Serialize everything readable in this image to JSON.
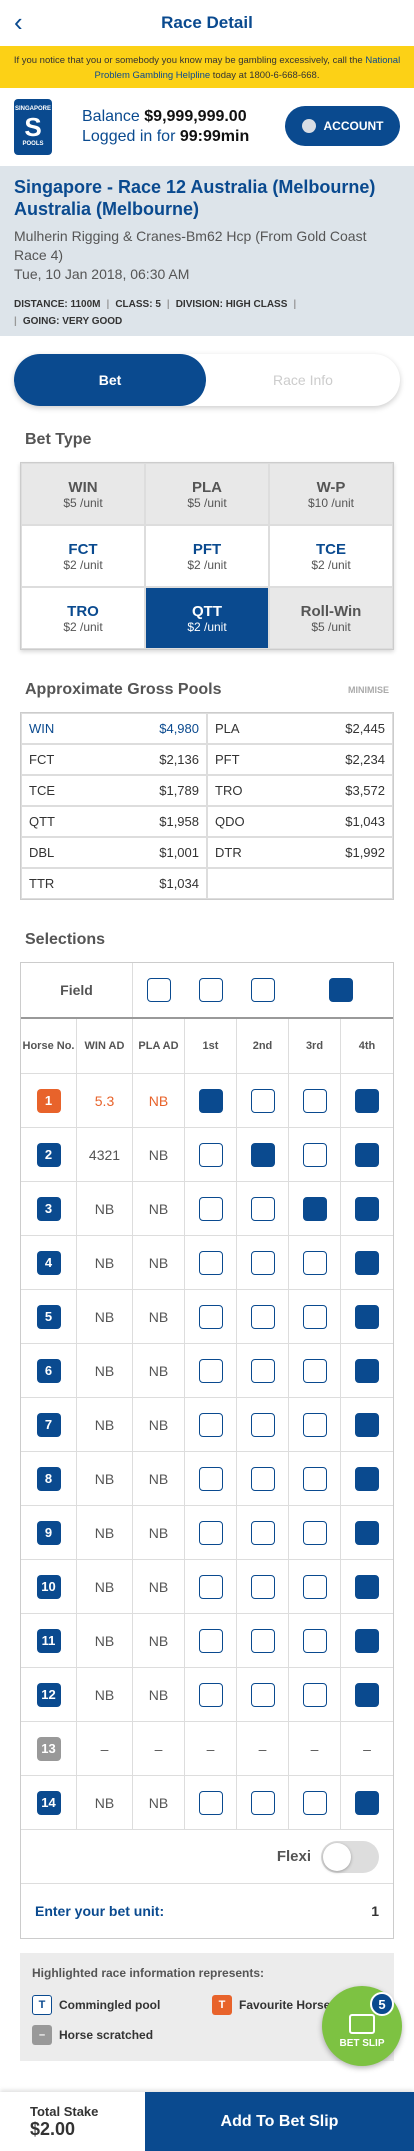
{
  "header": {
    "back_icon": "chevron-left-icon",
    "title": "Race Detail"
  },
  "warning": {
    "text": "If you notice that you or somebody you know may be gambling excessively, call the",
    "link": "National Problem Gambling Helpline",
    "suffix": "today at 1800-6-668-668."
  },
  "account": {
    "logo_top": "SINGAPORE",
    "logo_mid": "S",
    "logo_bottom": "POOLS",
    "balance_label": "Balance",
    "balance": "$9,999,999.00",
    "logged_label": "Logged in for",
    "logged_time": "99:99min",
    "button": "ACCOUNT"
  },
  "race": {
    "title": "Singapore - Race 12 Australia (Melbourne) Australia (Melbourne)",
    "name": "Mulherin Rigging & Cranes-Bm62 Hcp (From Gold Coast Race 4)",
    "date": "Tue, 10 Jan 2018, 06:30 AM",
    "distance": "DISTANCE: 1100M",
    "class": "CLASS: 5",
    "division": "DIVISION: HIGH CLASS",
    "going": "GOING: VERY GOOD"
  },
  "tabs": {
    "bet": "Bet",
    "info": "Race Info"
  },
  "bet_type": {
    "title": "Bet Type",
    "items": [
      {
        "name": "WIN",
        "unit": "$5 /unit",
        "style": "gray"
      },
      {
        "name": "PLA",
        "unit": "$5 /unit",
        "style": "gray"
      },
      {
        "name": "W-P",
        "unit": "$10 /unit",
        "style": "gray"
      },
      {
        "name": "FCT",
        "unit": "$2 /unit",
        "style": "white"
      },
      {
        "name": "PFT",
        "unit": "$2 /unit",
        "style": "white"
      },
      {
        "name": "TCE",
        "unit": "$2 /unit",
        "style": "white"
      },
      {
        "name": "TRO",
        "unit": "$2 /unit",
        "style": "white"
      },
      {
        "name": "QTT",
        "unit": "$2 /unit",
        "style": "sel"
      },
      {
        "name": "Roll-Win",
        "unit": "$5 /unit",
        "style": "gray"
      }
    ]
  },
  "pools": {
    "title": "Approximate Gross Pools",
    "minimise": "MINIMISE",
    "items": [
      {
        "name": "WIN",
        "value": "$4,980",
        "hl": true
      },
      {
        "name": "PLA",
        "value": "$2,445"
      },
      {
        "name": "FCT",
        "value": "$2,136"
      },
      {
        "name": "PFT",
        "value": "$2,234"
      },
      {
        "name": "TCE",
        "value": "$1,789"
      },
      {
        "name": "TRO",
        "value": "$3,572"
      },
      {
        "name": "QTT",
        "value": "$1,958"
      },
      {
        "name": "QDO",
        "value": "$1,043"
      },
      {
        "name": "DBL",
        "value": "$1,001"
      },
      {
        "name": "DTR",
        "value": "$1,992"
      },
      {
        "name": "TTR",
        "value": "$1,034"
      },
      {
        "name": "",
        "value": ""
      }
    ]
  },
  "selections": {
    "title": "Selections",
    "field_label": "Field",
    "field": [
      0,
      0,
      0,
      1
    ],
    "headers": [
      "Horse No.",
      "WIN AD",
      "PLA AD",
      "1st",
      "2nd",
      "3rd",
      "4th"
    ],
    "horses": [
      {
        "no": "1",
        "win": "5.3",
        "pla": "NB",
        "style": "or",
        "checks": [
          1,
          0,
          0,
          1
        ]
      },
      {
        "no": "2",
        "win": "4321",
        "pla": "NB",
        "style": "",
        "checks": [
          0,
          1,
          0,
          1
        ]
      },
      {
        "no": "3",
        "win": "NB",
        "pla": "NB",
        "style": "",
        "checks": [
          0,
          0,
          1,
          1
        ]
      },
      {
        "no": "4",
        "win": "NB",
        "pla": "NB",
        "style": "",
        "checks": [
          0,
          0,
          0,
          1
        ]
      },
      {
        "no": "5",
        "win": "NB",
        "pla": "NB",
        "style": "",
        "checks": [
          0,
          0,
          0,
          1
        ]
      },
      {
        "no": "6",
        "win": "NB",
        "pla": "NB",
        "style": "",
        "checks": [
          0,
          0,
          0,
          1
        ]
      },
      {
        "no": "7",
        "win": "NB",
        "pla": "NB",
        "style": "",
        "checks": [
          0,
          0,
          0,
          1
        ]
      },
      {
        "no": "8",
        "win": "NB",
        "pla": "NB",
        "style": "",
        "checks": [
          0,
          0,
          0,
          1
        ]
      },
      {
        "no": "9",
        "win": "NB",
        "pla": "NB",
        "style": "",
        "checks": [
          0,
          0,
          0,
          1
        ]
      },
      {
        "no": "10",
        "win": "NB",
        "pla": "NB",
        "style": "",
        "checks": [
          0,
          0,
          0,
          1
        ]
      },
      {
        "no": "11",
        "win": "NB",
        "pla": "NB",
        "style": "",
        "checks": [
          0,
          0,
          0,
          1
        ]
      },
      {
        "no": "12",
        "win": "NB",
        "pla": "NB",
        "style": "",
        "checks": [
          0,
          0,
          0,
          1
        ]
      },
      {
        "no": "13",
        "win": "–",
        "pla": "–",
        "style": "gr",
        "checks": null
      },
      {
        "no": "14",
        "win": "NB",
        "pla": "NB",
        "style": "",
        "checks": [
          0,
          0,
          0,
          1
        ]
      }
    ],
    "flexi": "Flexi",
    "unit_label": "Enter your bet unit:",
    "unit_value": "1"
  },
  "legend": {
    "title": "Highlighted race information represents:",
    "commingled": "Commingled pool",
    "favourite": "Favourite Horse",
    "scratched": "Horse scratched",
    "t_letter": "T"
  },
  "betslip": {
    "count": "5",
    "label": "BET SLIP"
  },
  "footer": {
    "stake_label": "Total Stake",
    "stake": "$2.00",
    "add": "Add To Bet Slip"
  },
  "colors": {
    "brand": "#0a4a8f",
    "warning": "#fcd116",
    "favourite": "#e8632b",
    "betslip": "#7dc242"
  }
}
